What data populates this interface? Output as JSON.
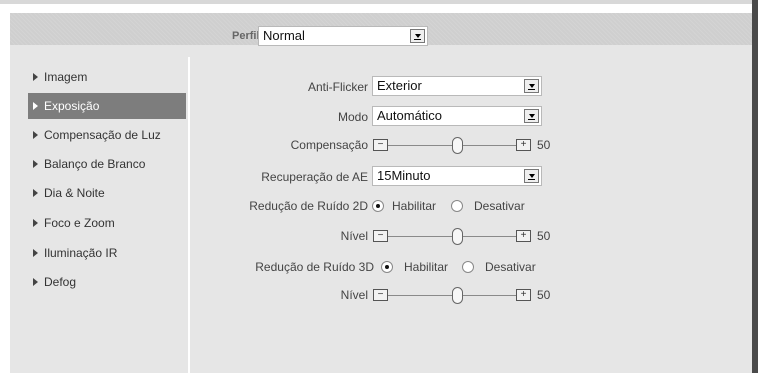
{
  "profile": {
    "label": "Perfil",
    "value": "Normal"
  },
  "sidebar": {
    "items": [
      {
        "label": "Imagem",
        "active": false
      },
      {
        "label": "Exposição",
        "active": true
      },
      {
        "label": "Compensação de Luz",
        "active": false
      },
      {
        "label": "Balanço de Branco",
        "active": false
      },
      {
        "label": "Dia & Noite",
        "active": false
      },
      {
        "label": "Foco e Zoom",
        "active": false
      },
      {
        "label": "Iluminação IR",
        "active": false
      },
      {
        "label": "Defog",
        "active": false
      }
    ]
  },
  "form": {
    "anti_flicker": {
      "label": "Anti-Flicker",
      "value": "Exterior"
    },
    "modo": {
      "label": "Modo",
      "value": "Automático"
    },
    "compensacao": {
      "label": "Compensação",
      "minus": "−",
      "plus": "+",
      "value": "50"
    },
    "recuperacao_ae": {
      "label": "Recuperação de AE",
      "value": "15Minuto"
    },
    "reducao_2d": {
      "label": "Redução de Ruído 2D",
      "option_on": "Habilitar",
      "option_off": "Desativar",
      "selected": "Habilitar"
    },
    "nivel_2d": {
      "label": "Nível",
      "minus": "−",
      "plus": "+",
      "value": "50"
    },
    "reducao_3d": {
      "label": "Redução de Ruído 3D",
      "option_on": "Habilitar",
      "option_off": "Desativar",
      "selected": "Habilitar"
    },
    "nivel_3d": {
      "label": "Nível",
      "minus": "−",
      "plus": "+",
      "value": "50"
    }
  }
}
